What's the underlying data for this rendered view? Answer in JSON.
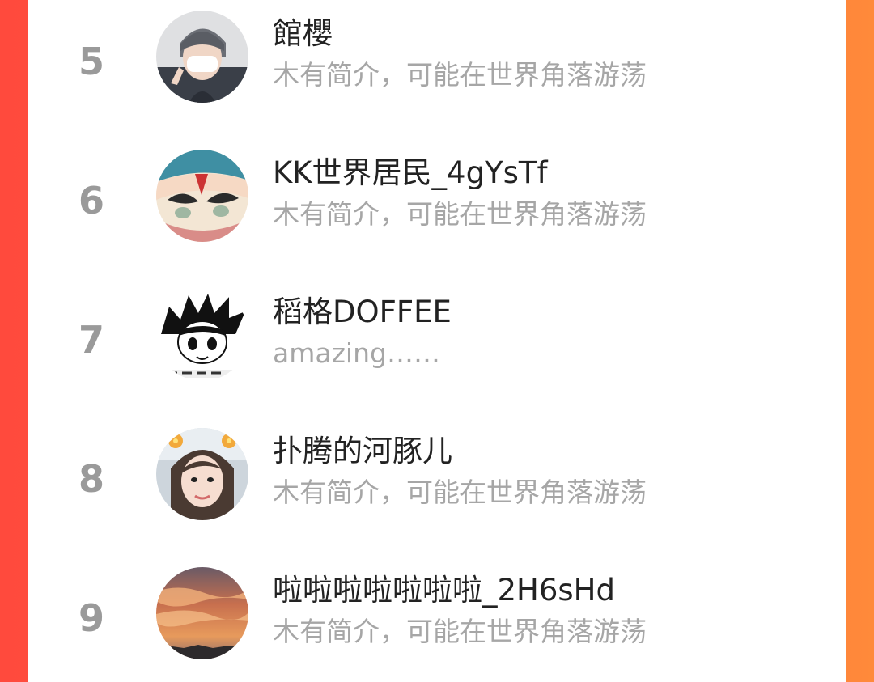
{
  "ranking": {
    "items": [
      {
        "rank": "5",
        "name": "館櫻",
        "bio": "木有简介，可能在世界角落游荡",
        "avatar_icon": "masked-boy-avatar"
      },
      {
        "rank": "6",
        "name": "KK世界居民_4gYsTf",
        "bio": "木有简介，可能在世界角落游荡",
        "avatar_icon": "opera-mask-avatar"
      },
      {
        "rank": "7",
        "name": "稻格DOFFEE",
        "bio": "amazing……",
        "avatar_icon": "cartoon-boy-avatar"
      },
      {
        "rank": "8",
        "name": "扑腾的河豚儿",
        "bio": "木有简介，可能在世界角落游荡",
        "avatar_icon": "girl-selfie-avatar"
      },
      {
        "rank": "9",
        "name": "啦啦啦啦啦啦啦_2H6sHd",
        "bio": "木有简介，可能在世界角落游荡",
        "avatar_icon": "sunset-sky-avatar"
      }
    ]
  },
  "colors": {
    "left_edge": "#ff4a3d",
    "right_edge": "#ff8a3a",
    "panel": "#ffffff",
    "rank_text": "#9a9a9a",
    "name_text": "#222222",
    "bio_text": "#a6a6a6"
  }
}
